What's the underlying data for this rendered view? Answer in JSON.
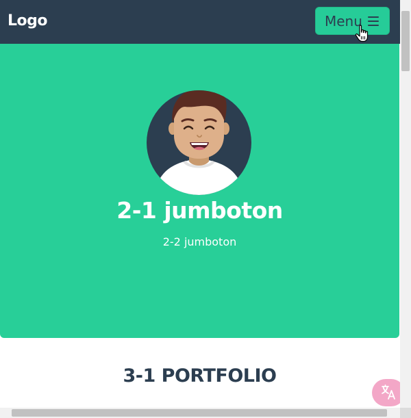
{
  "navbar": {
    "logo": "Logo",
    "menu_label": "Menu",
    "background": "#2c3e50"
  },
  "jumbotron": {
    "title": "2-1 jumboton",
    "subtitle": "2-2 jumboton",
    "background": "#28cf98"
  },
  "portfolio": {
    "title": "3-1 PORTFOLIO"
  },
  "icons": {
    "menu": "hamburger-icon",
    "cursor": "hand-pointer-icon",
    "translate": "translate-icon",
    "avatar": "avatar-illustration"
  },
  "colors": {
    "accent": "#26cc98",
    "dark": "#2c3e50",
    "translate_button": "#f3a7c7"
  }
}
